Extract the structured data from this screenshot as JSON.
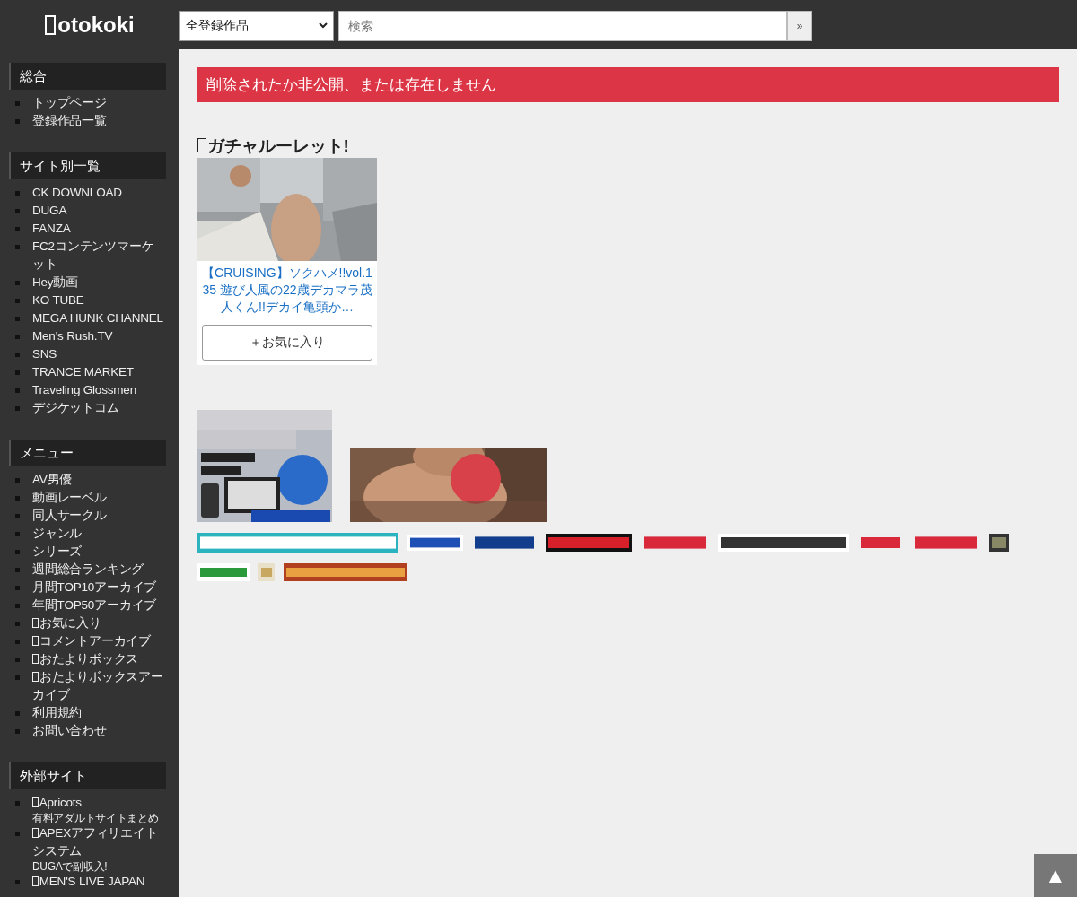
{
  "header": {
    "logo": {
      "icon": true,
      "text": "otokoki"
    },
    "category_select": {
      "value": "全登録作品"
    },
    "search": {
      "placeholder": "検索"
    },
    "search_button": "»"
  },
  "sidebar": [
    {
      "heading": "総合",
      "items": [
        {
          "label": "トップページ"
        },
        {
          "label": "登録作品一覧"
        }
      ]
    },
    {
      "heading": "サイト別一覧",
      "items": [
        {
          "label": "CK DOWNLOAD"
        },
        {
          "label": "DUGA"
        },
        {
          "label": "FANZA"
        },
        {
          "label": "FC2コンテンツマーケット"
        },
        {
          "label": "Hey動画"
        },
        {
          "label": "KO TUBE"
        },
        {
          "label": "MEGA HUNK CHANNEL"
        },
        {
          "label": "Men's Rush.TV"
        },
        {
          "label": "SNS"
        },
        {
          "label": "TRANCE MARKET"
        },
        {
          "label": "Traveling Glossmen"
        },
        {
          "label": "デジケットコム"
        }
      ]
    },
    {
      "heading": "メニュー",
      "items": [
        {
          "label": "AV男優"
        },
        {
          "label": "動画レーベル"
        },
        {
          "label": "同人サークル"
        },
        {
          "label": "ジャンル"
        },
        {
          "label": "シリーズ"
        },
        {
          "label": "週間総合ランキング"
        },
        {
          "label": "月間TOP10アーカイブ"
        },
        {
          "label": "年間TOP50アーカイブ"
        },
        {
          "label": "お気に入り",
          "icon": true
        },
        {
          "label": "コメントアーカイブ",
          "icon": true
        },
        {
          "label": "おたよりボックス",
          "icon": true
        },
        {
          "label": "おたよりボックスアーカイブ",
          "icon": true
        },
        {
          "label": "利用規約"
        },
        {
          "label": "お問い合わせ"
        }
      ]
    },
    {
      "heading": "外部サイト",
      "items": [
        {
          "label": "Apricots",
          "icon": true,
          "sub": "有料アダルトサイトまとめ"
        },
        {
          "label": "APEXアフィリエイトシステム",
          "icon": true,
          "sub": "DUGAで副収入!"
        },
        {
          "label": "MEN'S LIVE JAPAN",
          "icon": true
        }
      ]
    }
  ],
  "alert": "削除されたか非公開、または存在しません",
  "gacha": {
    "heading": {
      "icon": true,
      "text": "ガチャルーレット!"
    },
    "card": {
      "title": "【CRUISING】ソクハメ!!vol.135 遊び人風の22歳デカマラ茂人くん!!デカイ亀頭か…",
      "favorite_button": "＋お気に入り"
    }
  },
  "scroll_top_button": "▲"
}
